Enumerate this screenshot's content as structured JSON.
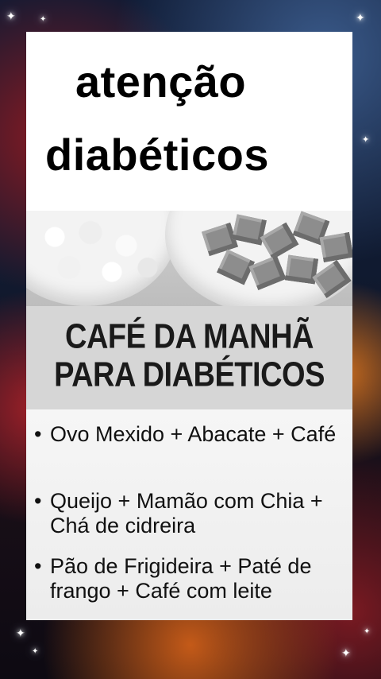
{
  "headline": {
    "line1": "atenção",
    "line2": "diabéticos"
  },
  "banner": {
    "line1": "CAFÉ DA MANHÃ",
    "line2": "PARA DIABÉTICOS"
  },
  "items": [
    {
      "bullet": "•",
      "text": "Ovo Mexido + Abacate + Café"
    },
    {
      "bullet": "•",
      "text": "Queijo + Mamão com Chia + Chá de cidreira"
    },
    {
      "bullet": "•",
      "text": "Pão de Frigideira + Paté de frango + Café com leite"
    }
  ],
  "colors": {
    "card_background": "#ffffff",
    "banner_background": "#d6d6d6",
    "text": "#111111"
  },
  "icons": [
    "sparkle-star-icon"
  ]
}
